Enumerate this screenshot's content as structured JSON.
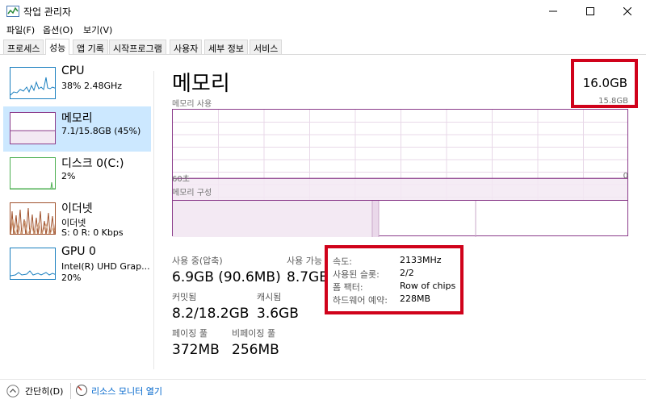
{
  "window": {
    "title": "작업 관리자"
  },
  "menu": {
    "file": "파일(F)",
    "options": "옵션(O)",
    "view": "보기(V)"
  },
  "tabs": [
    "프로세스",
    "성능",
    "앱 기록",
    "시작프로그램",
    "사용자",
    "세부 정보",
    "서비스"
  ],
  "resources": [
    {
      "name": "CPU",
      "sub": "38% 2.48GHz"
    },
    {
      "name": "메모리",
      "sub": "7.1/15.8GB (45%)"
    },
    {
      "name": "디스크 0(C:)",
      "sub": "2%"
    },
    {
      "name": "이더넷",
      "sub": "이더넷",
      "sub2": "S: 0 R: 0 Kbps"
    },
    {
      "name": "GPU 0",
      "sub": "Intel(R) UHD Grap...",
      "sub2": "20%"
    }
  ],
  "main": {
    "title": "메모리",
    "capacity": "16.0GB",
    "usage_label": "메모리 사용",
    "usage_max": "15.8GB",
    "time_left": "60초",
    "time_right": "0",
    "composition_label": "메모리 구성"
  },
  "stats": {
    "in_use_label": "사용 중(압축)",
    "in_use_value": "6.9GB (90.6MB)",
    "available_label": "사용 가능",
    "available_value": "8.7GB",
    "committed_label": "커밋됨",
    "committed_value": "8.2/18.2GB",
    "cached_label": "캐시됨",
    "cached_value": "3.6GB",
    "paged_label": "페이징 풀",
    "paged_value": "372MB",
    "nonpaged_label": "비페이징 풀",
    "nonpaged_value": "256MB"
  },
  "specs": [
    {
      "key": "속도:",
      "value": "2133MHz"
    },
    {
      "key": "사용된 슬롯:",
      "value": "2/2"
    },
    {
      "key": "폼 팩터:",
      "value": "Row of chips"
    },
    {
      "key": "하드웨어 예약:",
      "value": "228MB"
    }
  ],
  "bottom": {
    "fewer_details": "간단히(D)",
    "open_monitor": "리소스 모니터 열기"
  },
  "colors": {
    "memory": "#8b3c8b",
    "cpu": "#1a7fbf",
    "disk": "#4caf50",
    "ethernet": "#a0522d",
    "highlight": "#d0021b",
    "selected_bg": "#cce8ff"
  },
  "memory_graph": {
    "used_fraction": 0.45
  }
}
